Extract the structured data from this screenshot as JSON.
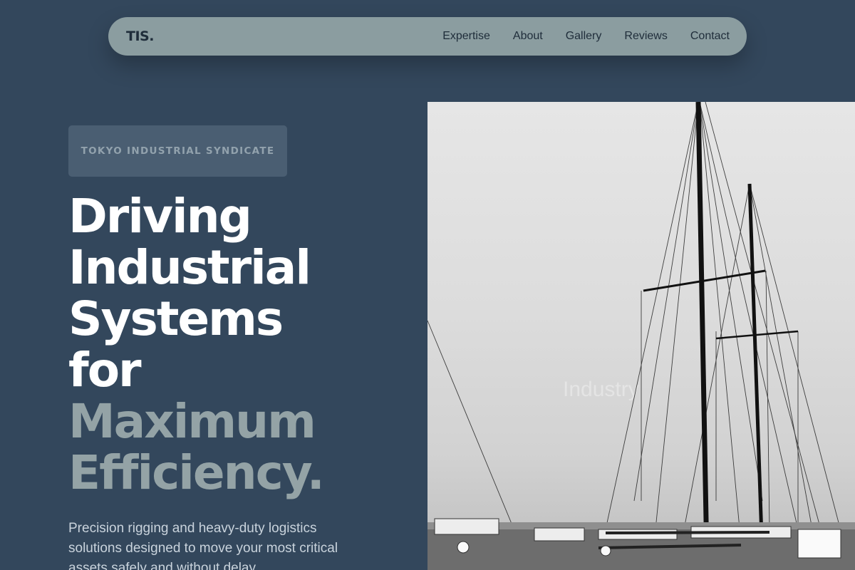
{
  "nav": {
    "logo": "TIS.",
    "links": [
      "Expertise",
      "About",
      "Gallery",
      "Reviews",
      "Contact"
    ]
  },
  "hero": {
    "badge": "TOKYO INDUSTRIAL SYNDICATE",
    "headline_white": [
      "Driving",
      "Industrial",
      "Systems",
      "for"
    ],
    "headline_accent": [
      "Maximum",
      "Efficiency."
    ],
    "subtext": "Precision rigging and heavy-duty logistics solutions designed to move your most critical assets safely and without delay."
  },
  "image": {
    "subject": "sailing-ship-masts-photo",
    "overlay_text": "Industry"
  },
  "colors": {
    "background": "#33475c",
    "nav_bg": "#8b9da0",
    "badge_bg": "#4a5e72",
    "accent_text": "#94a3a6"
  }
}
